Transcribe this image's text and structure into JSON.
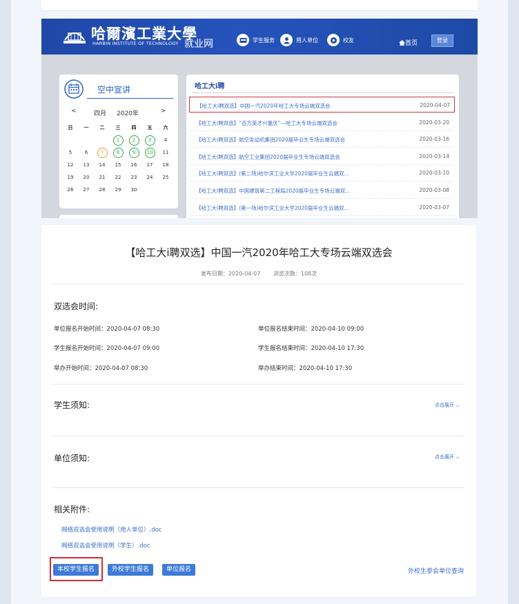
{
  "header": {
    "logo_text": "哈爾濱工業大學",
    "logo_sub": "HARBIN INSTITUTE OF TECHNOLOGY",
    "site_name": "就业网",
    "nav": [
      {
        "label": "学生服务",
        "icon": "student-service-icon"
      },
      {
        "label": "用人单位",
        "icon": "employer-icon"
      },
      {
        "label": "校友",
        "icon": "alumni-icon"
      }
    ],
    "home_label": "首页",
    "login_label": "登录"
  },
  "calendar": {
    "title": "空中宣讲",
    "prev": "<",
    "next": ">",
    "month": "四月",
    "year": "2020年",
    "weekdays": [
      "日",
      "一",
      "二",
      "三",
      "四",
      "五",
      "六"
    ],
    "weeks": [
      [
        "",
        "",
        "",
        "1",
        "2",
        "3",
        "4"
      ],
      [
        "5",
        "6",
        "7",
        "8",
        "9",
        "10",
        "11"
      ],
      [
        "12",
        "13",
        "14",
        "15",
        "16",
        "17",
        "18"
      ],
      [
        "19",
        "20",
        "21",
        "22",
        "23",
        "24",
        "25"
      ],
      [
        "26",
        "27",
        "28",
        "29",
        "30",
        "",
        ""
      ]
    ],
    "marked_green": [
      "1",
      "2",
      "3",
      "8",
      "9",
      "10"
    ],
    "marked_orange": [
      "7"
    ],
    "colors": {
      "green": "#35a653",
      "orange": "#f09a2a",
      "accent": "#2a62c9"
    }
  },
  "news": {
    "title": "哈工大i聘",
    "items": [
      {
        "title": "【哈工大i聘双选】中国一汽2020年哈工大专场云端双选会",
        "date": "2020-04-07"
      },
      {
        "title": "【哈工大i聘双选】“百万英才兴重庆”—哈工大专场云端双选会",
        "date": "2020-03-20"
      },
      {
        "title": "【哈工大i聘双选】航空发动机集团2020届毕业生专场云端双选会",
        "date": "2020-03-16"
      },
      {
        "title": "【哈工大i聘双选】航空工业集团2020届毕业生专场云端双选会",
        "date": "2020-03-14"
      },
      {
        "title": "【哈工大i聘双选】(第二场)哈尔滨工业大学2020届毕业生云端双...",
        "date": "2020-03-10"
      },
      {
        "title": "【哈工大i聘双选】中国建筑第二工程局2020届毕业生专场云端双...",
        "date": "2020-03-08"
      },
      {
        "title": "【哈工大i聘双选】(第一场)哈尔滨工业大学2020届毕业生云端双...",
        "date": "2020-03-07"
      }
    ]
  },
  "detail": {
    "title": "【哈工大i聘双选】中国一汽2020年哈工大专场云端双选会",
    "publish_date": "发布日期：2020-04-07",
    "views": "浏览次数：108次",
    "schedule_title": "双选会时间:",
    "schedule": [
      {
        "label": "单位报名开始时间：2020-04-07 08:30",
        "label2": "单位报名结束时间：2020-04-10 09:00"
      },
      {
        "label": "学生报名开始时间：2020-04-07 09:00",
        "label2": "学生报名结束时间：2020-04-10 17:30"
      },
      {
        "label": "举办开始时间：2020-04-07 08:30",
        "label2": "举办结束时间：2020-04-10 17:30"
      }
    ],
    "student_notice_title": "学生须知:",
    "unit_notice_title": "单位须知:",
    "expand_label": "点击展开",
    "attachments_title": "相关附件:",
    "attachments": [
      "网络双选会使用说明（用人单位）.doc",
      "网络双选会使用说明（学生）.doc"
    ],
    "buttons": [
      "本校学生报名",
      "外校学生报名",
      "单位报名"
    ],
    "external_query": "外校生参会单位查询",
    "accent": "#3e7ad7",
    "highlight": "#cf2c36"
  }
}
